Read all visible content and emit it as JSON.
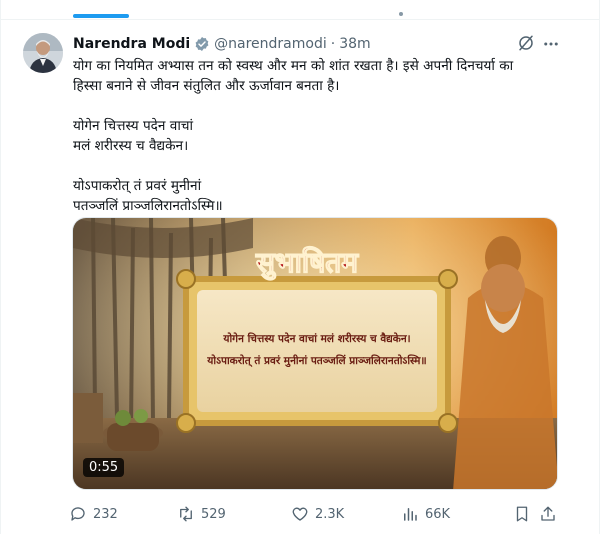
{
  "tweet": {
    "author_name": "Narendra Modi",
    "handle": "@narendramodi",
    "separator": "·",
    "time": "38m",
    "lines": [
      "योग का नियमित अभ्यास तन को स्वस्थ और मन को शांत रखता है। इसे अपनी दिनचर्या का",
      "हिस्सा बनाने से जीवन संतुलित और ऊर्जावान बनता है।",
      "योगेन चित्तस्य पदेन वाचां",
      "मलं शरीरस्य च वैद्यकेन।",
      "योऽपाकरोत् तं प्रवरं मुनीनां",
      "पतञ्जलिं प्राञ्जलिरानतोऽस्मि॥"
    ]
  },
  "media": {
    "title": "सुभाषितम",
    "verse_line_1": "योगेन चित्तस्य पदेन वाचां मलं शरीरस्य च वैद्यकेन।",
    "verse_line_2": "योऽपाकरोत् तं प्रवरं मुनीनां पतञ्जलिं प्राञ्जलिरानतोऽस्मि॥",
    "duration": "0:55"
  },
  "actions": {
    "replies": "232",
    "reposts": "529",
    "likes": "2.3K",
    "views": "66K"
  },
  "colors": {
    "accent": "#1d9bf0",
    "secondary_text": "#536471",
    "title_red": "#b5171b",
    "frame_gold": "#c79a3d"
  }
}
